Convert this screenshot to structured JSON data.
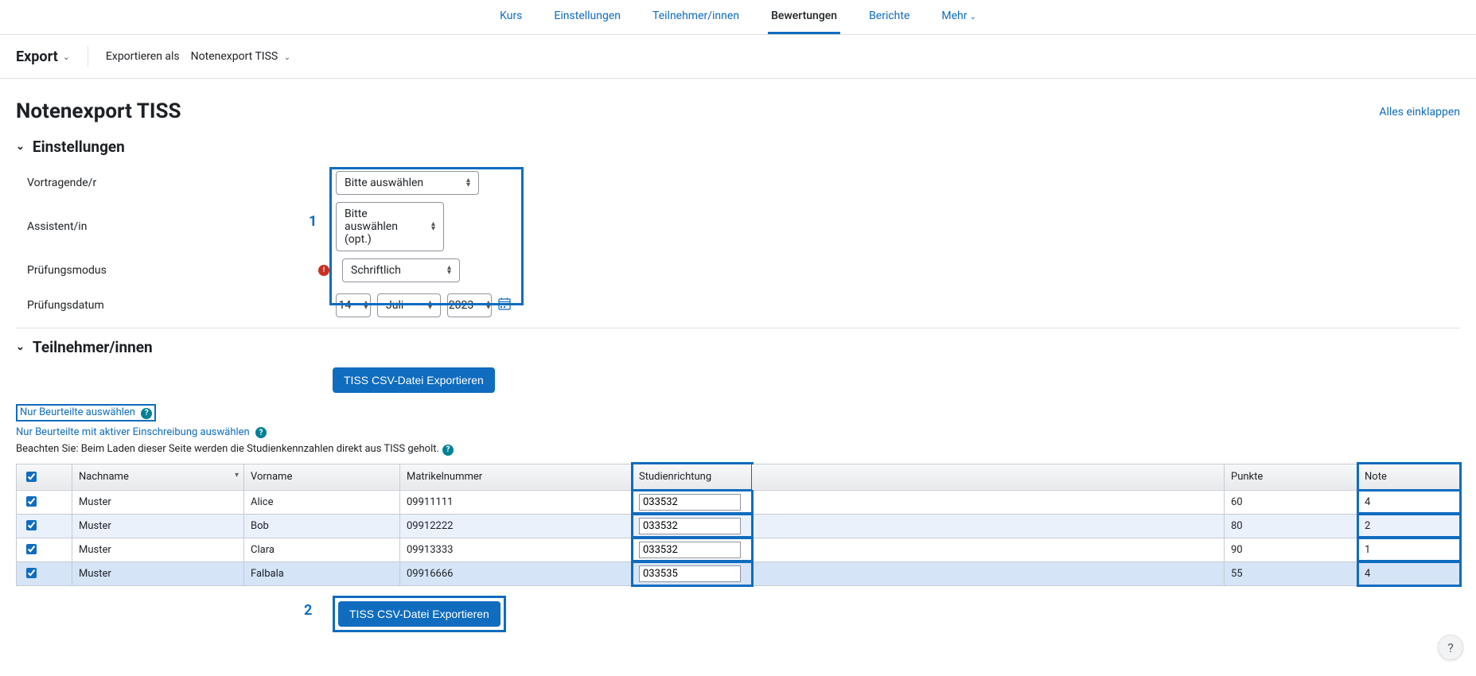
{
  "nav": {
    "tabs": [
      "Kurs",
      "Einstellungen",
      "Teilnehmer/innen",
      "Bewertungen",
      "Berichte",
      "Mehr"
    ],
    "active_index": 3
  },
  "header": {
    "export_label": "Export",
    "export_as_label": "Exportieren als",
    "export_type": "Notenexport TISS"
  },
  "page_title": "Notenexport TISS",
  "collapse_all": "Alles einklappen",
  "section_settings": {
    "title": "Einstellungen",
    "lecturer_label": "Vortragende/r",
    "lecturer_value": "Bitte auswählen",
    "assistant_label": "Assistent/in",
    "assistant_value": "Bitte auswählen (opt.)",
    "exam_mode_label": "Prüfungsmodus",
    "exam_mode_value": "Schriftlich",
    "exam_date_label": "Prüfungsdatum",
    "date_day": "14",
    "date_month": "Juli",
    "date_year": "2023"
  },
  "annotations": {
    "num1": "1",
    "num2": "2"
  },
  "section_participants": {
    "title": "Teilnehmer/innen",
    "export_button": "TISS CSV-Datei Exportieren",
    "link_only_graded": "Nur Beurteilte auswählen",
    "link_only_graded_enrolled": "Nur Beurteilte mit aktiver Einschreibung auswählen",
    "note": "Beachten Sie: Beim Laden dieser Seite werden die Studienkennzahlen direkt aus TISS geholt."
  },
  "table": {
    "headers": {
      "nachname": "Nachname",
      "vorname": "Vorname",
      "matrikel": "Matrikelnummer",
      "studien": "Studienrichtung",
      "punkte": "Punkte",
      "note": "Note"
    },
    "rows": [
      {
        "checked": true,
        "nachname": "Muster",
        "vorname": "Alice",
        "matrikel": "09911111",
        "studien": "033532",
        "punkte": "60",
        "note": "4"
      },
      {
        "checked": true,
        "nachname": "Muster",
        "vorname": "Bob",
        "matrikel": "09912222",
        "studien": "033532",
        "punkte": "80",
        "note": "2"
      },
      {
        "checked": true,
        "nachname": "Muster",
        "vorname": "Clara",
        "matrikel": "09913333",
        "studien": "033532",
        "punkte": "90",
        "note": "1"
      },
      {
        "checked": true,
        "nachname": "Muster",
        "vorname": "Falbala",
        "matrikel": "09916666",
        "studien": "033535",
        "punkte": "55",
        "note": "4"
      }
    ]
  },
  "help_fab": "?"
}
